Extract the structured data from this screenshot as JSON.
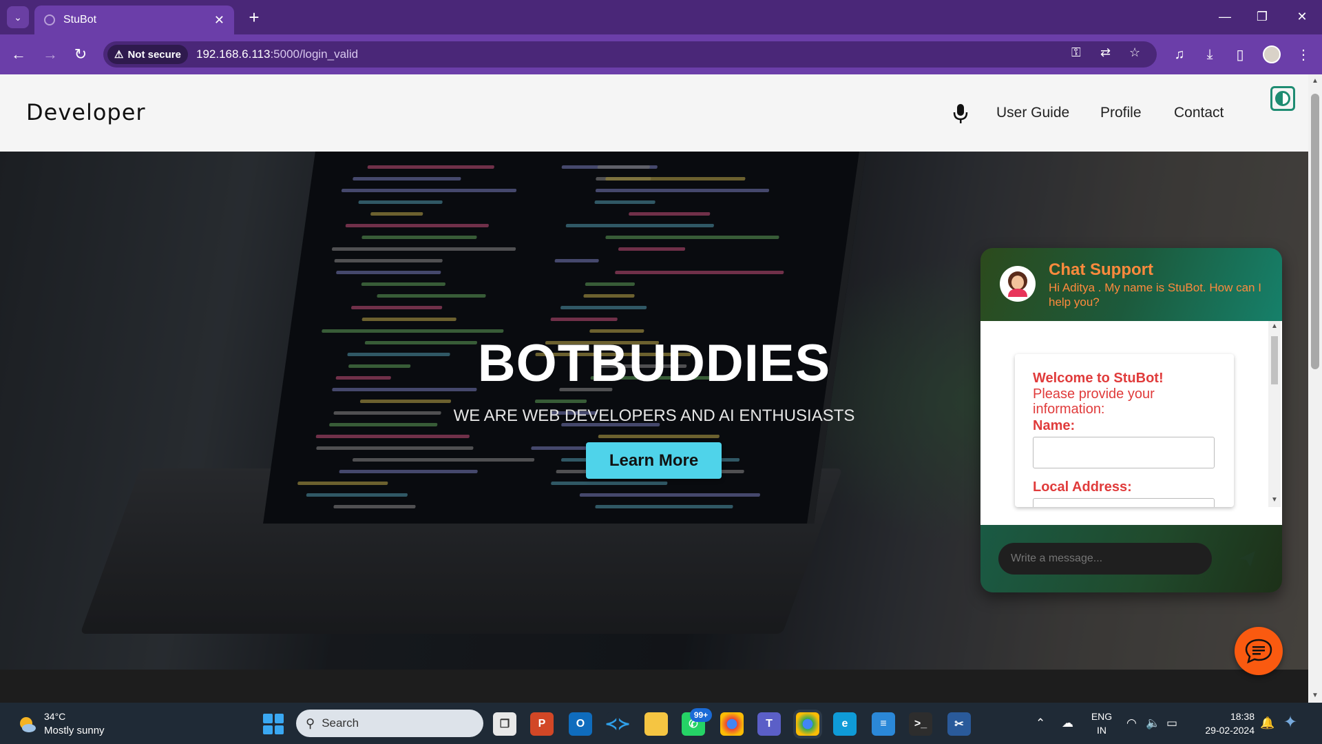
{
  "browser": {
    "tab_title": "StuBot",
    "new_tab": "+",
    "security_label": "Not secure",
    "url_host": "192.168.6.113",
    "url_path": ":5000/login_valid"
  },
  "site": {
    "brand": "Developer",
    "nav": [
      "User Guide",
      "Profile",
      "Contact"
    ]
  },
  "hero": {
    "title": "BOTBUDDIES",
    "subtitle": "WE ARE WEB DEVELOPERS AND AI ENTHUSIASTS",
    "button": "Learn More"
  },
  "chat": {
    "title": "Chat Support",
    "greeting": "Hi Aditya . My name is StuBot. How can I help you?",
    "form_welcome": "Welcome to StuBot!",
    "form_info": "Please provide your information:",
    "name_label": "Name:",
    "address_label": "Local Address:",
    "input_placeholder": "Write a message..."
  },
  "taskbar": {
    "weather_temp": "34°C",
    "weather_cond": "Mostly sunny",
    "search": "Search",
    "badge": "99+",
    "lang": "ENG",
    "region": "IN",
    "time": "18:38",
    "date": "29-02-2024"
  },
  "colors": {
    "browser_accent": "#6b3ea9",
    "hero_button": "#4fd3ea",
    "chat_title": "#ff8a3d",
    "form_text": "#e03b3b",
    "fab": "#fa5a10"
  }
}
